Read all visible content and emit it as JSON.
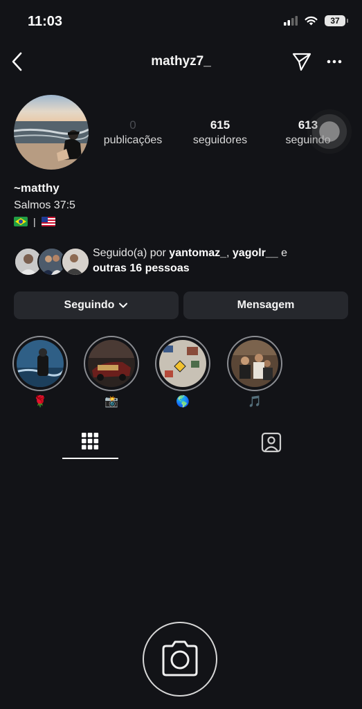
{
  "status_bar": {
    "time": "11:03",
    "battery": "37"
  },
  "header": {
    "username": "mathyz7_"
  },
  "profile": {
    "stats": {
      "posts": {
        "value": "0",
        "label": "publicações"
      },
      "followers": {
        "value": "615",
        "label": "seguidores"
      },
      "following": {
        "value": "613",
        "label": "seguindo"
      }
    },
    "display_name": "~matthy",
    "bio": "Salmos 37:5",
    "bio_flags_separator": "|"
  },
  "followed_by": {
    "prefix": "Seguido(a) por ",
    "user1": "yantomaz_",
    "comma": ", ",
    "user2": "yagolr__",
    "conjunction": " e",
    "others": "outras 16 pessoas"
  },
  "actions": {
    "following_label": "Seguindo",
    "message_label": "Mensagem"
  },
  "highlights": [
    {
      "emoji": "🌹"
    },
    {
      "emoji": "📸"
    },
    {
      "emoji": "🌎"
    },
    {
      "emoji": "🎵"
    }
  ],
  "colors": {
    "background": "#121317",
    "button": "#26282d",
    "text": "#f5f5f5"
  }
}
